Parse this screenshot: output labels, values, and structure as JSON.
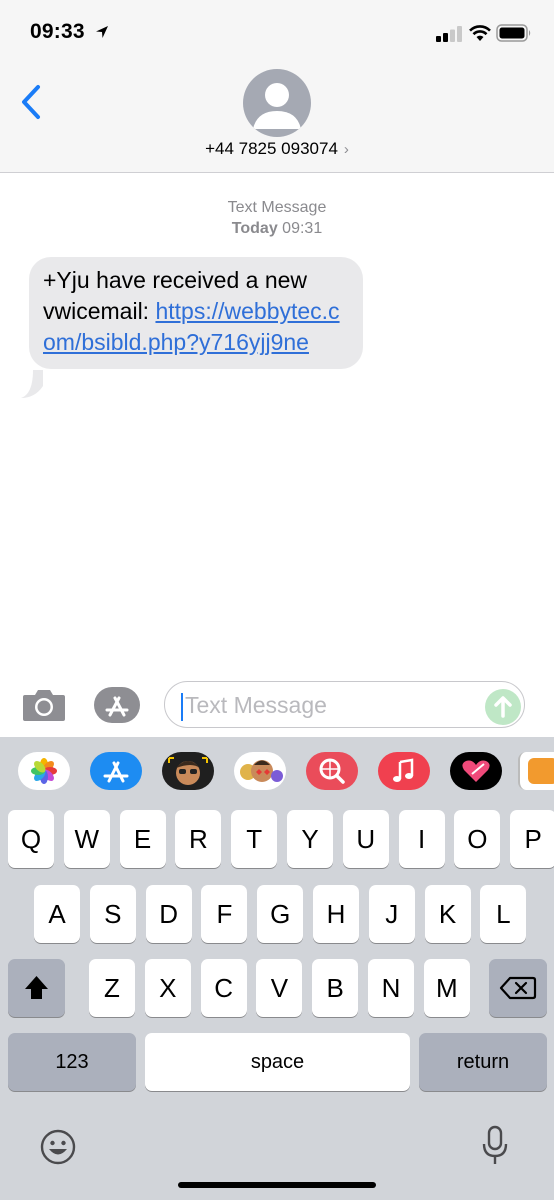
{
  "status_bar": {
    "time": "09:33"
  },
  "header": {
    "contact": "+44 7825 093074",
    "chevron": "›"
  },
  "conversation": {
    "meta_label": "Text Message",
    "meta_day": "Today",
    "meta_time": "09:31",
    "message_text": "+Yju have received a new vwicemail: ",
    "message_link": "https://webbytec.com/bsibld.php?y716yjj9ne"
  },
  "composer": {
    "placeholder": "Text Message"
  },
  "keyboard": {
    "row1": [
      "Q",
      "W",
      "E",
      "R",
      "T",
      "Y",
      "U",
      "I",
      "O",
      "P"
    ],
    "row2": [
      "A",
      "S",
      "D",
      "F",
      "G",
      "H",
      "J",
      "K",
      "L"
    ],
    "row3": [
      "Z",
      "X",
      "C",
      "V",
      "B",
      "N",
      "M"
    ],
    "numbers_label": "123",
    "space_label": "space",
    "return_label": "return"
  },
  "colors": {
    "link": "#2f6fd8",
    "accent": "#1a7cf7",
    "bubble": "#e9e9eb",
    "keyboard_bg": "#d1d4d9"
  },
  "icons": [
    "location-arrow-icon",
    "signal-icon",
    "wifi-icon",
    "battery-icon",
    "back-chevron-icon",
    "contact-avatar-icon",
    "camera-icon",
    "app-store-icon",
    "send-arrow-icon",
    "shift-icon",
    "backspace-icon",
    "emoji-icon",
    "microphone-icon"
  ]
}
